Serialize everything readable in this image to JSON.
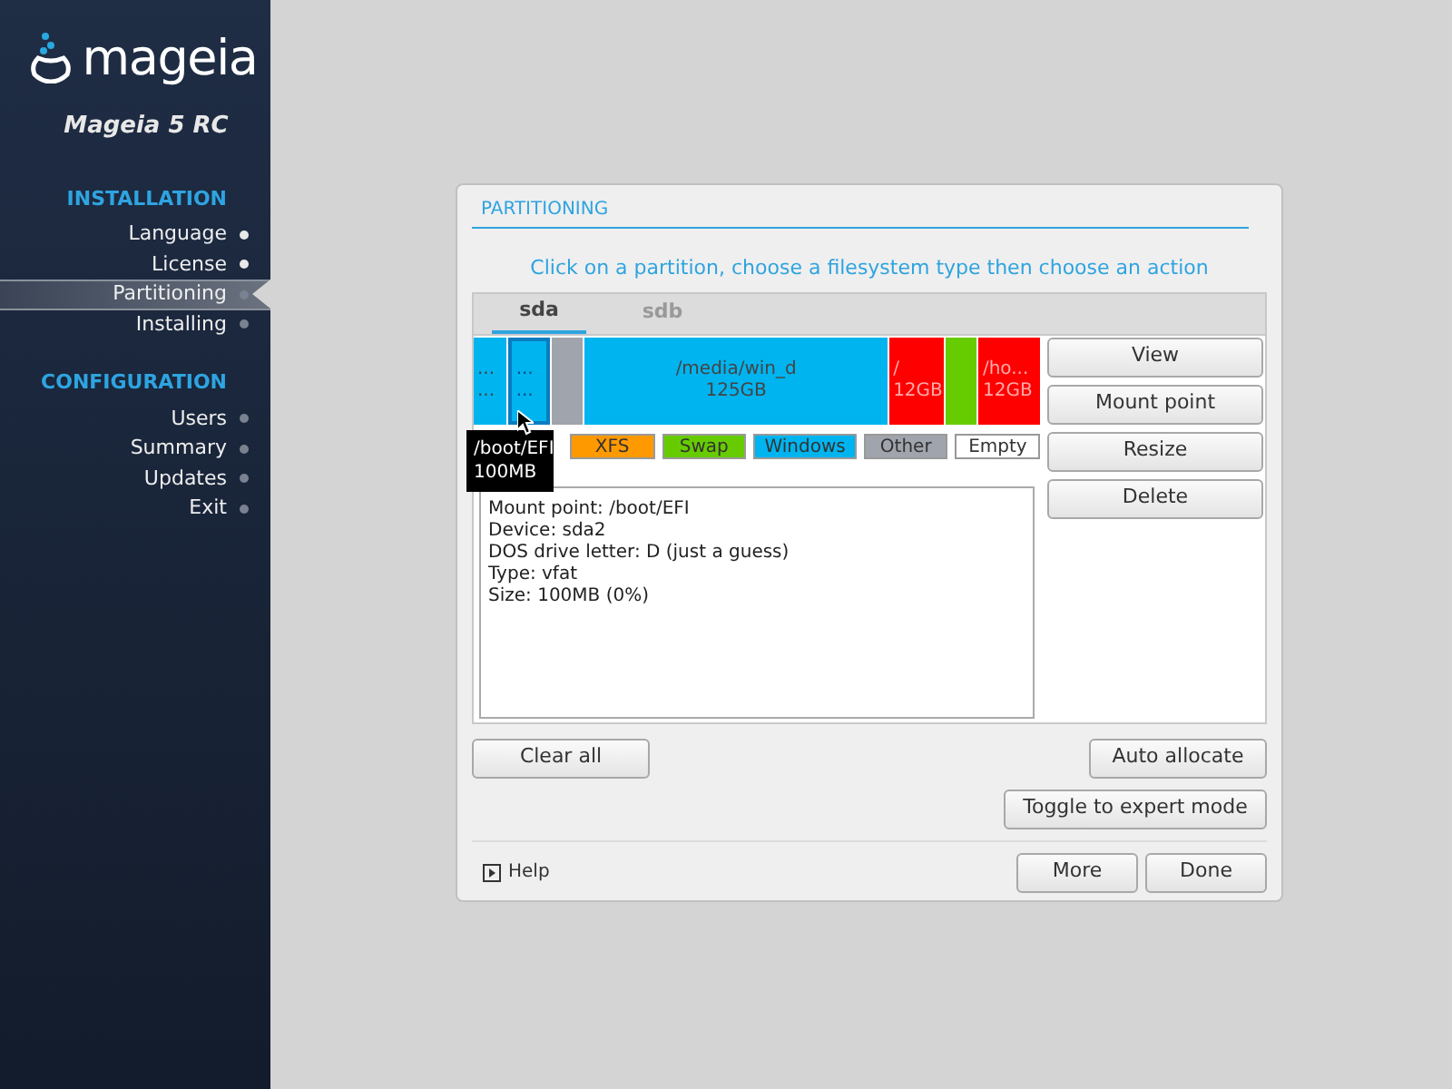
{
  "sidebar": {
    "logo_text": "mageia",
    "version": "Mageia 5 RC",
    "sections": [
      {
        "title": "INSTALLATION",
        "items": [
          {
            "label": "Language",
            "selected": false,
            "done": true
          },
          {
            "label": "License",
            "selected": false,
            "done": true
          },
          {
            "label": "Partitioning",
            "selected": true,
            "done": false
          },
          {
            "label": "Installing",
            "selected": false,
            "done": false
          }
        ]
      },
      {
        "title": "CONFIGURATION",
        "items": [
          {
            "label": "Users",
            "selected": false,
            "done": false
          },
          {
            "label": "Summary",
            "selected": false,
            "done": false
          },
          {
            "label": "Updates",
            "selected": false,
            "done": false
          },
          {
            "label": "Exit",
            "selected": false,
            "done": false
          }
        ]
      }
    ]
  },
  "dialog": {
    "title": "PARTITIONING",
    "instruction": "Click on a partition, choose a filesystem type then choose an action",
    "tabs": [
      {
        "label": "sda",
        "selected": true
      },
      {
        "label": "sdb",
        "selected": false
      }
    ],
    "partitions": [
      {
        "lines": [
          "...",
          "..."
        ],
        "color": "#00b4f0",
        "selected": false
      },
      {
        "lines": [
          "...",
          "..."
        ],
        "color": "#00b4f0",
        "selected": true
      },
      {
        "color": "#a0a4ac",
        "selected": false
      },
      {
        "lines": [
          "/media/win_d",
          "125GB"
        ],
        "color": "#00b4f0",
        "selected": false
      },
      {
        "lines": [
          "/",
          "12GB"
        ],
        "color": "#ff0000",
        "selected": false
      },
      {
        "color": "#66cc00",
        "selected": false
      },
      {
        "lines": [
          "/ho...",
          "12GB"
        ],
        "color": "#ff0000",
        "selected": false
      }
    ],
    "legend": [
      {
        "label": "XFS",
        "color": "#ff9900"
      },
      {
        "label": "Swap",
        "color": "#66cc00"
      },
      {
        "label": "Windows",
        "color": "#00b4f0"
      },
      {
        "label": "Other",
        "color": "#a0a4ac"
      },
      {
        "label": "Empty",
        "color": "#ffffff"
      }
    ],
    "tooltip": [
      "/boot/EFI",
      "100MB"
    ],
    "info": [
      "Mount point: /boot/EFI",
      "Device: sda2",
      "DOS drive letter: D (just a guess)",
      "Type: vfat",
      "Size: 100MB (0%)"
    ],
    "actions": [
      "View",
      "Mount point",
      "Resize",
      "Delete"
    ],
    "clear_button": "Clear all",
    "auto_button": "Auto allocate",
    "expert_button": "Toggle to expert mode",
    "help": "Help",
    "more_button": "More",
    "done_button": "Done"
  }
}
